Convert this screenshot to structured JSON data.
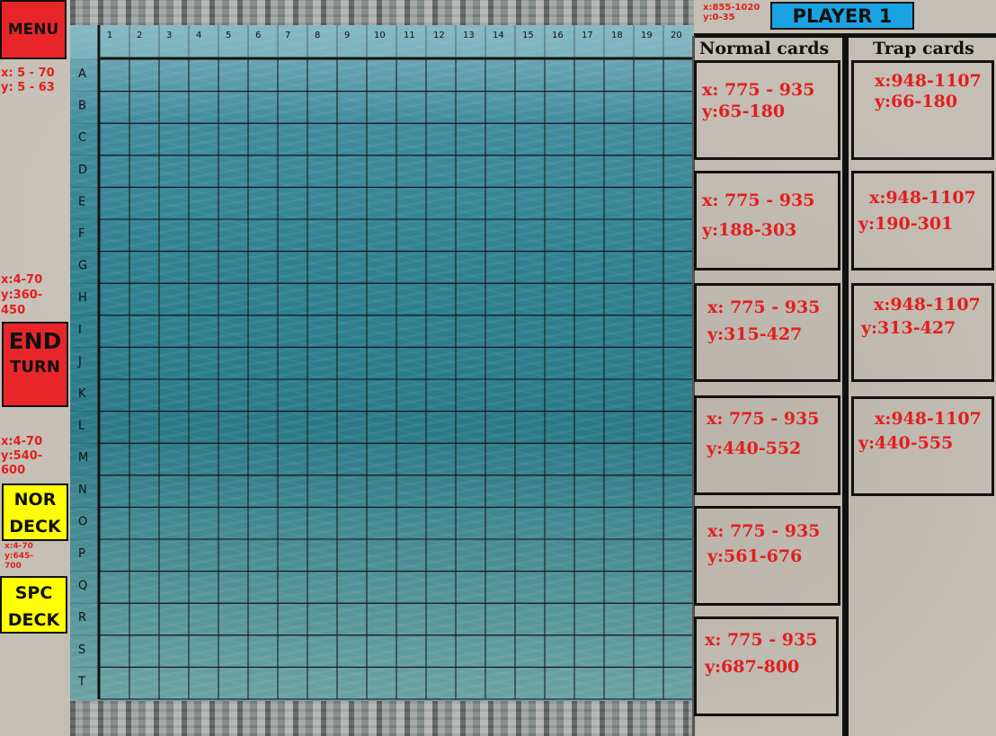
{
  "left": {
    "menu_label": "MENU",
    "menu_note": "x: 5 - 70\ny: 5 - 63",
    "end_turn_note": "x:4-70\ny:360-\n450",
    "end_turn_label_1": "END",
    "end_turn_label_2": "TURN",
    "nor_deck_note": "x:4-70\ny:540-\n600",
    "nor_deck_label_1": "NOR",
    "nor_deck_label_2": "DECK",
    "spc_deck_note": "x:4-70\ny:645-\n700",
    "spc_deck_label_1": "SPC",
    "spc_deck_label_2": "DECK"
  },
  "board": {
    "columns": [
      "1",
      "2",
      "3",
      "4",
      "5",
      "6",
      "7",
      "8",
      "9",
      "10",
      "11",
      "12",
      "13",
      "14",
      "15",
      "16",
      "17",
      "18",
      "19",
      "20"
    ],
    "rows": [
      "A",
      "B",
      "C",
      "D",
      "E",
      "F",
      "G",
      "H",
      "I",
      "J",
      "K",
      "L",
      "M",
      "N",
      "O",
      "P",
      "Q",
      "R",
      "S",
      "T"
    ]
  },
  "header": {
    "banner_note": "x:855-1020\ny:0-35",
    "player_label": "PLAYER 1"
  },
  "normal": {
    "heading": "Normal cards",
    "slots": [
      {
        "x": "x: 775 - 935",
        "y": "y:65-180"
      },
      {
        "x": "x: 775 - 935",
        "y": "y:188-303"
      },
      {
        "x": "x: 775 - 935",
        "y": "y:315-427"
      },
      {
        "x": "x: 775 - 935",
        "y": "y:440-552"
      },
      {
        "x": "x: 775 - 935",
        "y": "y:561-676"
      },
      {
        "x": "x: 775 - 935",
        "y": "y:687-800"
      }
    ]
  },
  "trap": {
    "heading": "Trap cards",
    "slots": [
      {
        "x": "x:948-1107",
        "y": "y:66-180"
      },
      {
        "x": "x:948-1107",
        "y": "y:190-301"
      },
      {
        "x": "x:948-1107",
        "y": "y:313-427"
      },
      {
        "x": "x:948-1107",
        "y": "y:440-555"
      }
    ]
  },
  "colors": {
    "button_red": "#e8262a",
    "button_yellow": "#ffff00",
    "banner_blue": "#1aa3e3",
    "note_red": "#e21e1e"
  }
}
